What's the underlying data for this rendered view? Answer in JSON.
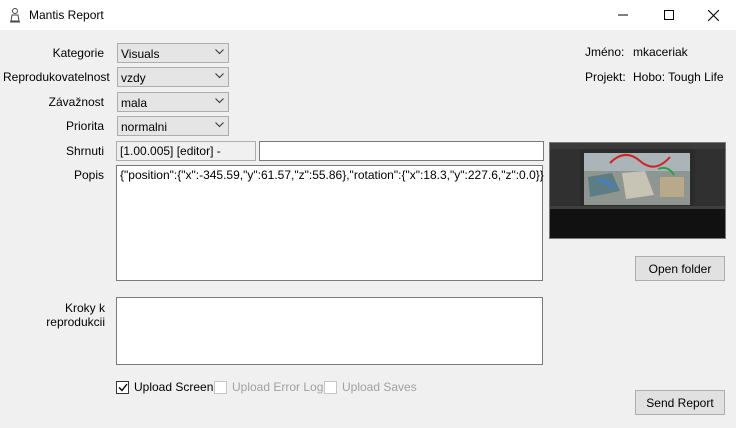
{
  "window": {
    "title": "Mantis Report",
    "app_icon": "mantis-icon",
    "controls": [
      "minimize-icon",
      "maximize-icon",
      "close-icon"
    ]
  },
  "form": {
    "category_label": "Kategorie",
    "category_value": "Visuals",
    "reproducibility_label": "Reprodukovatelnost",
    "reproducibility_value": "vzdy",
    "severity_label": "Závažnost",
    "severity_value": "mala",
    "priority_label": "Priorita",
    "priority_value": "normalni",
    "summary_label": "Shrnuti",
    "summary_prefix": "[1.00.005] [editor] -",
    "summary_value": "",
    "description_label": "Popis",
    "description_value": "{\"position\":{\"x\":-345.59,\"y\":61.57,\"z\":55.86},\"rotation\":{\"x\":18.3,\"y\":227.6,\"z\":0.0}}",
    "steps_label": "Kroky k reprodukcii",
    "steps_value": ""
  },
  "info": {
    "name_label": "Jméno:",
    "name_value": "mkaceriak",
    "project_label": "Projekt:",
    "project_value": "Hobo: Tough Life"
  },
  "checkboxes": {
    "upload_screen": "Upload Screen",
    "upload_screen_checked": true,
    "upload_error_log": "Upload Error Log",
    "upload_saves": "Upload Saves"
  },
  "buttons": {
    "open_folder": "Open folder",
    "send_report": "Send Report"
  },
  "colors": {
    "window_bg": "#f0f0f0",
    "titlebar_bg": "#ffffff",
    "button_bg": "#e1e1e1",
    "disabled_text": "#a0a0a0"
  }
}
